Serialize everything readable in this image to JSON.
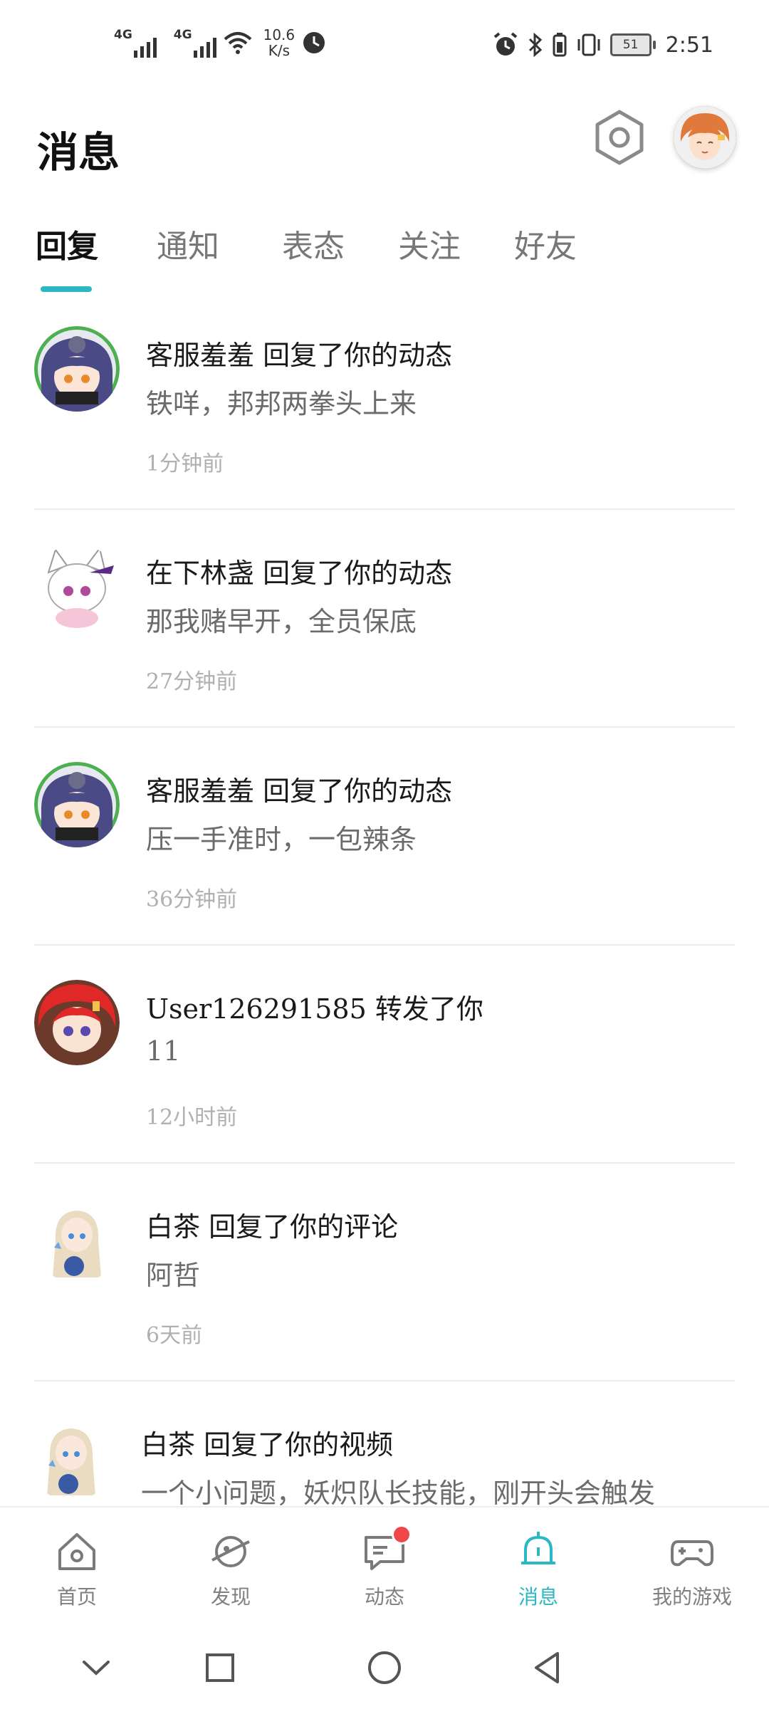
{
  "status_bar": {
    "signal1_label": "4G",
    "signal2_label": "4G",
    "net_speed_value": "10.6",
    "net_speed_unit": "K/s",
    "battery_level": "51",
    "time": "2:51"
  },
  "header": {
    "title": "消息"
  },
  "tabs": [
    {
      "label": "回复",
      "active": true
    },
    {
      "label": "通知",
      "active": false
    },
    {
      "label": "表态",
      "active": false
    },
    {
      "label": "关注",
      "active": false
    },
    {
      "label": "好友",
      "active": false
    }
  ],
  "messages": [
    {
      "title": "客服羞羞  回复了你的动态",
      "body": "铁咩，邦邦两拳头上来",
      "time": "1分钟前"
    },
    {
      "title": "在下林盏  回复了你的动态",
      "body": "那我赌早开，全员保底",
      "time": "27分钟前"
    },
    {
      "title": "客服羞羞  回复了你的动态",
      "body": "压一手准时，一包辣条",
      "time": "36分钟前"
    },
    {
      "title": "User126291585  转发了你",
      "body": "11",
      "time": "12小时前"
    },
    {
      "title": "白茶  回复了你的评论",
      "body": "阿哲",
      "time": "6天前"
    },
    {
      "title": "白茶  回复了你的视频",
      "body": "一个小问题，妖炽队长技能，刚开头会触发",
      "time": ""
    }
  ],
  "bottom_nav": [
    {
      "label": "首页",
      "icon": "home-icon"
    },
    {
      "label": "发现",
      "icon": "planet-icon"
    },
    {
      "label": "动态",
      "icon": "chat-icon"
    },
    {
      "label": "消息",
      "icon": "bell-icon"
    },
    {
      "label": "我的游戏",
      "icon": "gamepad-icon"
    }
  ],
  "colors": {
    "accent": "#2bb7c4",
    "badge": "#f04848"
  }
}
